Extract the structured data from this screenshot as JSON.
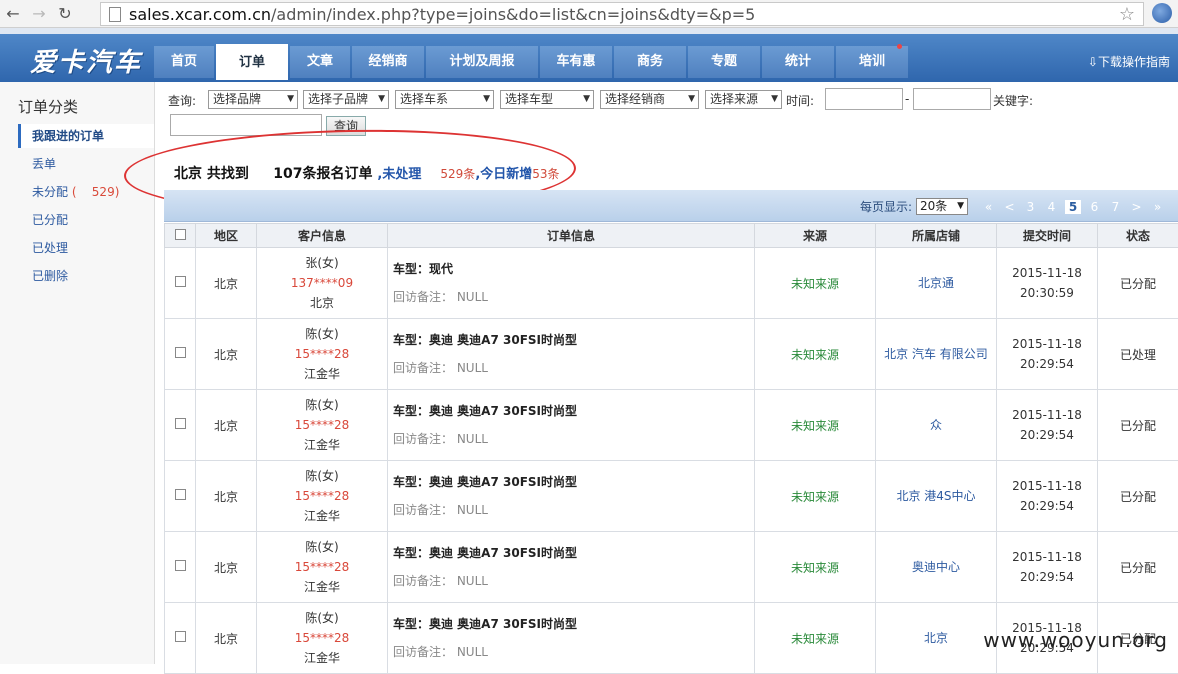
{
  "browser": {
    "url_host": "sales.xcar.com.cn",
    "url_path": "/admin/index.php?type=joins&do=list&cn=joins&dty=&p=5"
  },
  "header": {
    "logo": "爱卡汽车",
    "menu": [
      "首页",
      "订单",
      "文章",
      "经销商",
      "计划及周报",
      "车有惠",
      "商务",
      "专题",
      "统计",
      "培训"
    ],
    "download": "下载操作指南"
  },
  "sidebar": {
    "title": "订单分类",
    "items": [
      "我跟进的订单",
      "丢单",
      "未分配",
      "已分配",
      "已处理",
      "已删除"
    ],
    "unassigned_count": "529"
  },
  "filter": {
    "query_label": "查询:",
    "brand": "选择品牌",
    "sub_brand": "选择子品牌",
    "series": "选择车系",
    "model": "选择车型",
    "dealer": "选择经销商",
    "source": "选择来源",
    "time_label": "时间:",
    "dash": "-",
    "keyword_label": "关键字:",
    "query_button": "查询"
  },
  "summary": {
    "city_found": "北京 共找到",
    "total": "107条报名订单",
    "unprocessed_label": "未处理",
    "unprocessed_count": "529条",
    "today_label": "今日新增",
    "today_count": "53条"
  },
  "pager": {
    "per_page_label": "每页显示:",
    "per_page": "20条",
    "first": "«",
    "prev": "<",
    "pages": [
      "3",
      "4",
      "5",
      "6",
      "7"
    ],
    "current": "5",
    "next": ">",
    "last": "»"
  },
  "table": {
    "headers": [
      "",
      "地区",
      "客户信息",
      "订单信息",
      "来源",
      "所属店铺",
      "提交时间",
      "状态"
    ],
    "rows": [
      {
        "region": "北京",
        "name": "张(女)",
        "phone": "137****09",
        "addr": "北京",
        "car": "车型：现代",
        "note": "回访备注： NULL",
        "source": "未知来源",
        "store": "北京通",
        "date": "2015-11-18",
        "time": "20:30:59",
        "status": "已分配"
      },
      {
        "region": "北京",
        "name": "陈(女)",
        "phone": "15****28",
        "addr": "江金华",
        "car": "车型：奥迪 奥迪A7 30FSI时尚型",
        "note": "回访备注： NULL",
        "source": "未知来源",
        "store": "北京 汽车 有限公司",
        "date": "2015-11-18",
        "time": "20:29:54",
        "status": "已处理"
      },
      {
        "region": "北京",
        "name": "陈(女)",
        "phone": "15****28",
        "addr": "江金华",
        "car": "车型：奥迪 奥迪A7 30FSI时尚型",
        "note": "回访备注： NULL",
        "source": "未知来源",
        "store": "众",
        "date": "2015-11-18",
        "time": "20:29:54",
        "status": "已分配"
      },
      {
        "region": "北京",
        "name": "陈(女)",
        "phone": "15****28",
        "addr": "江金华",
        "car": "车型：奥迪 奥迪A7 30FSI时尚型",
        "note": "回访备注： NULL",
        "source": "未知来源",
        "store": "北京 港4S中心",
        "date": "2015-11-18",
        "time": "20:29:54",
        "status": "已分配"
      },
      {
        "region": "北京",
        "name": "陈(女)",
        "phone": "15****28",
        "addr": "江金华",
        "car": "车型：奥迪 奥迪A7 30FSI时尚型",
        "note": "回访备注： NULL",
        "source": "未知来源",
        "store": "奥迪中心",
        "date": "2015-11-18",
        "time": "20:29:54",
        "status": "已分配"
      },
      {
        "region": "北京",
        "name": "陈(女)",
        "phone": "15****28",
        "addr": "江金华",
        "car": "车型：奥迪 奥迪A7 30FSI时尚型",
        "note": "回访备注： NULL",
        "source": "未知来源",
        "store": "北京",
        "date": "2015-11-18",
        "time": "20:29:54",
        "status": "已分配"
      }
    ]
  },
  "watermark": "www.wooyun.org"
}
